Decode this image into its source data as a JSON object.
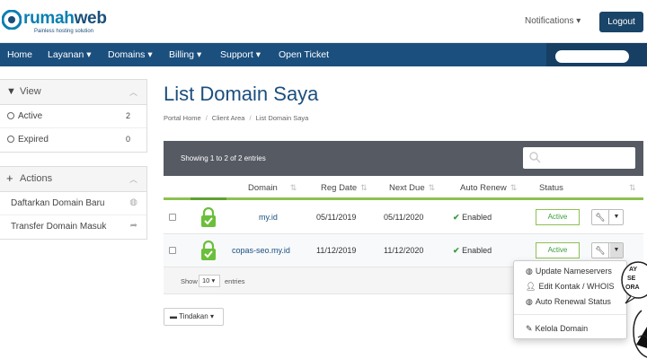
{
  "brand": {
    "name_part1": "rumah",
    "name_part2": "web",
    "tagline": "Painless hosting solution"
  },
  "header": {
    "notifications": "Notifications",
    "logout": "Logout"
  },
  "nav": {
    "items": [
      "Home",
      "Layanan",
      "Domains",
      "Billing",
      "Support",
      "Open Ticket"
    ]
  },
  "sidebar": {
    "view": {
      "title": "View",
      "items": [
        {
          "label": "Active",
          "count": "2"
        },
        {
          "label": "Expired",
          "count": "0"
        }
      ]
    },
    "actions": {
      "title": "Actions",
      "items": [
        {
          "label": "Daftarkan Domain Baru",
          "icon": "globe-icon"
        },
        {
          "label": "Transfer Domain Masuk",
          "icon": "share-icon"
        }
      ]
    }
  },
  "main": {
    "title": "List Domain Saya",
    "breadcrumb": [
      "Portal Home",
      "Client Area",
      "List Domain Saya"
    ],
    "table_info": "Showing 1 to 2 of 2 entries",
    "columns": [
      "Domain",
      "Reg Date",
      "Next Due",
      "Auto Renew",
      "Status"
    ],
    "rows": [
      {
        "domain": "my.id",
        "reg_date": "05/11/2019",
        "next_due": "05/11/2020",
        "auto_renew": "Enabled",
        "status": "Active"
      },
      {
        "domain": "copas-seo.my.id",
        "reg_date": "11/12/2019",
        "next_due": "11/12/2020",
        "auto_renew": "Enabled",
        "status": "Active"
      }
    ],
    "show_label": "Show",
    "show_value": "10",
    "entries_label": "entries",
    "tindakan": "Tindakan"
  },
  "dropdown": {
    "items": [
      "Update Nameservers",
      "Edit Kontak / WHOIS",
      "Auto Renewal Status",
      "Kelola Domain"
    ]
  },
  "mascot": {
    "text_lines": [
      "AY",
      "SE",
      "ORA"
    ]
  },
  "colors": {
    "primary": "#1b4f7e",
    "accent_green": "#8cc152",
    "table_head": "#555a63"
  }
}
